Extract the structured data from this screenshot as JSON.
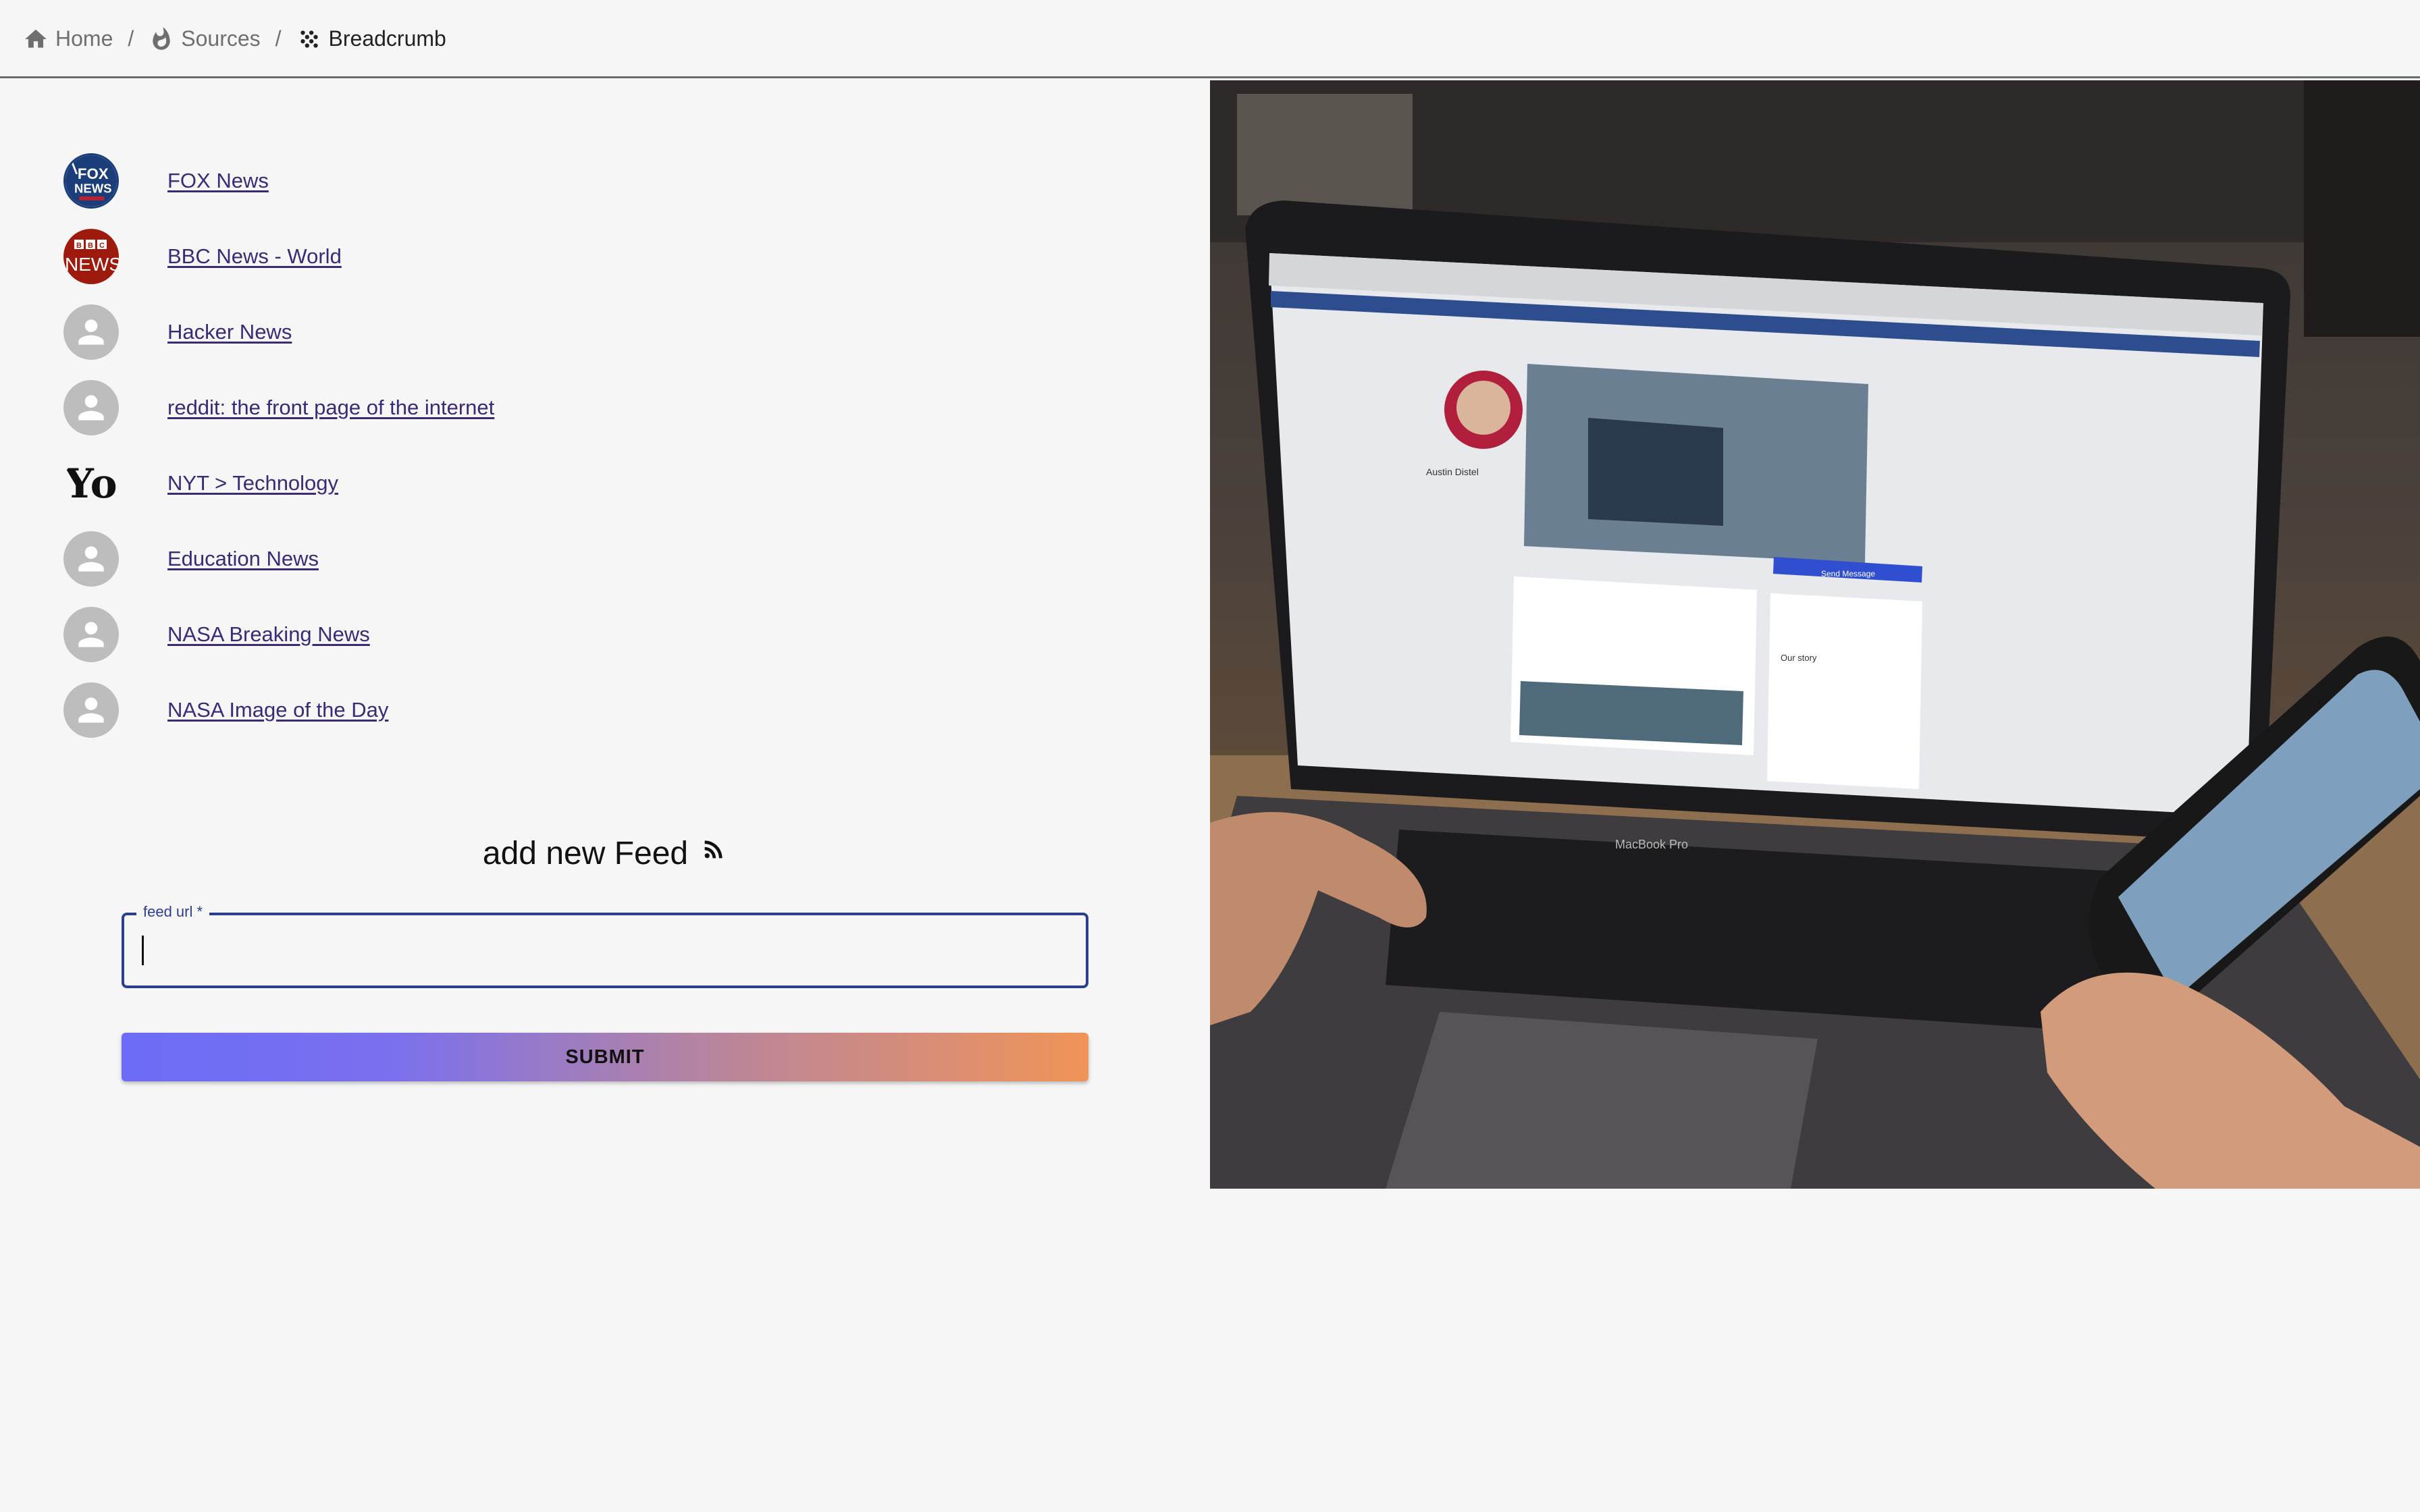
{
  "breadcrumb": {
    "items": [
      {
        "label": "Home",
        "icon": "home-icon"
      },
      {
        "label": "Sources",
        "icon": "fire-icon"
      },
      {
        "label": "Breadcrumb",
        "icon": "grain-icon"
      }
    ],
    "separator": "/"
  },
  "feeds": [
    {
      "title": "FOX News",
      "avatar": "fox-news-logo"
    },
    {
      "title": "BBC News - World",
      "avatar": "bbc-news-logo"
    },
    {
      "title": "Hacker News",
      "avatar": "default-person-icon"
    },
    {
      "title": "reddit: the front page of the internet",
      "avatar": "default-person-icon"
    },
    {
      "title": "NYT > Technology",
      "avatar": "nyt-logo"
    },
    {
      "title": "Education News",
      "avatar": "default-person-icon"
    },
    {
      "title": "NASA Breaking News",
      "avatar": "default-person-icon"
    },
    {
      "title": "NASA Image of the Day",
      "avatar": "default-person-icon"
    }
  ],
  "add_feed": {
    "title": "add new Feed",
    "icon": "rss-icon",
    "field_label": "feed url *",
    "field_value": "",
    "submit_label": "SUBMIT"
  },
  "photo_screen": {
    "profile_name": "Austin Distel",
    "button": "Send Message",
    "section": "Our story",
    "laptop_brand": "MacBook Pro"
  },
  "colors": {
    "background": "#f6f6f6",
    "link": "#3b2a78",
    "field_border": "#2c3f8f",
    "button_gradient_start": "#6c6cf6",
    "button_gradient_end": "#f09458"
  }
}
